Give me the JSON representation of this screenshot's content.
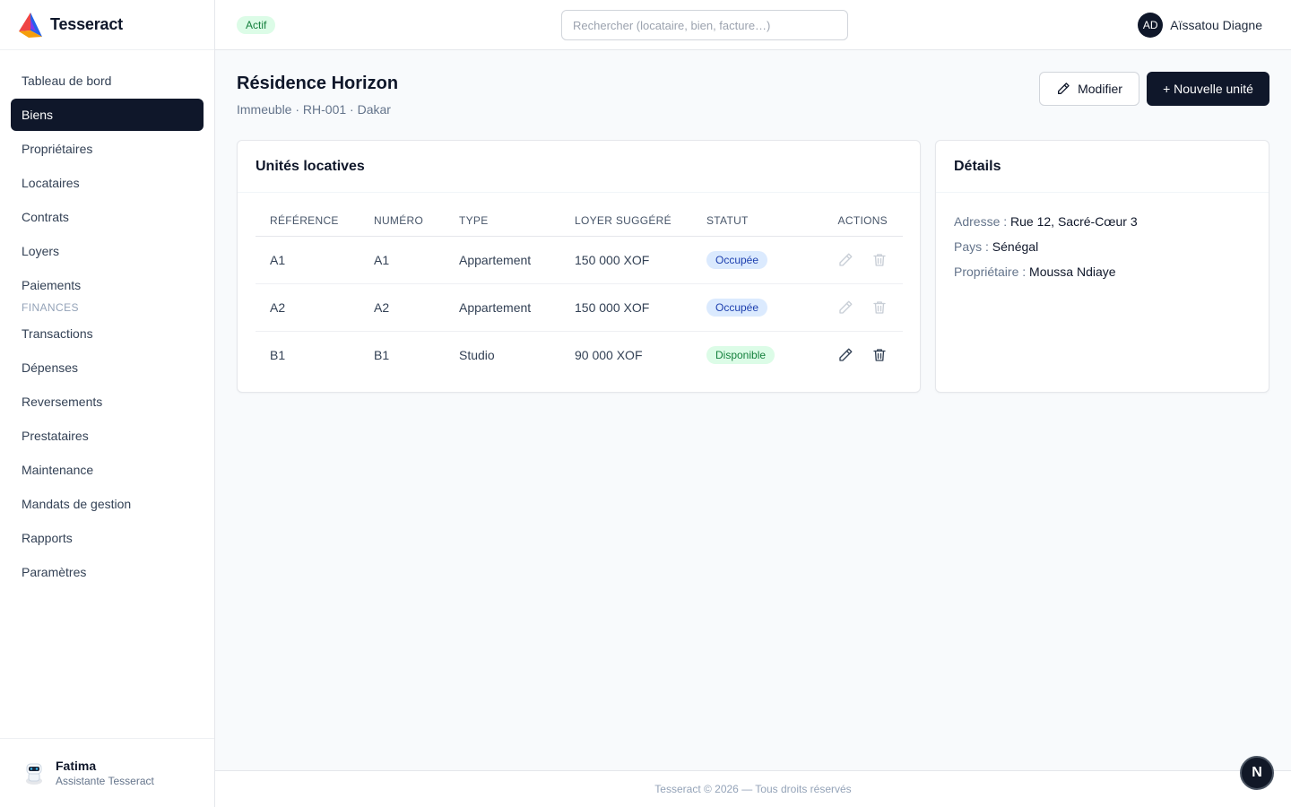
{
  "brand": {
    "name": "Tesseract"
  },
  "sidebar": {
    "items": [
      {
        "label": "Tableau de bord"
      },
      {
        "label": "Biens"
      },
      {
        "label": "Propriétaires"
      },
      {
        "label": "Locataires"
      },
      {
        "label": "Contrats"
      },
      {
        "label": "Loyers"
      },
      {
        "label": "Paiements"
      }
    ],
    "section_finances": "FINANCES",
    "finance_items": [
      {
        "label": "Transactions"
      },
      {
        "label": "Dépenses"
      },
      {
        "label": "Reversements"
      },
      {
        "label": "Prestataires"
      },
      {
        "label": "Maintenance"
      },
      {
        "label": "Mandats de gestion"
      },
      {
        "label": "Rapports"
      },
      {
        "label": "Paramètres"
      }
    ],
    "active": "Biens"
  },
  "assistant": {
    "name": "Fatima",
    "role": "Assistante Tesseract"
  },
  "topbar": {
    "status": "Actif",
    "search_placeholder": "Rechercher (locataire, bien, facture…)",
    "user_initials": "AD",
    "user_name": "Aïssatou Diagne"
  },
  "page": {
    "title": "Résidence Horizon",
    "subtitle": "Immeuble · RH-001 · Dakar",
    "edit_label": "Modifier",
    "new_label": "+ Nouvelle unité"
  },
  "units": {
    "title": "Unités locatives",
    "columns": [
      "RÉFÉRENCE",
      "NUMÉRO",
      "TYPE",
      "LOYER SUGGÉRÉ",
      "STATUT",
      "ACTIONS"
    ],
    "rows": [
      {
        "ref": "A1",
        "num": "A1",
        "type": "Appartement",
        "rent": "150 000 XOF",
        "status": "Occupée"
      },
      {
        "ref": "A2",
        "num": "A2",
        "type": "Appartement",
        "rent": "150 000 XOF",
        "status": "Occupée"
      },
      {
        "ref": "B1",
        "num": "B1",
        "type": "Studio",
        "rent": "90 000 XOF",
        "status": "Disponible"
      }
    ]
  },
  "details": {
    "title": "Détails",
    "address_label": "Adresse :",
    "address_value": "Rue 12, Sacré-Cœur 3",
    "country_label": "Pays :",
    "country_value": "Sénégal",
    "owner_label": "Propriétaire :",
    "owner_value": "Moussa Ndiaye"
  },
  "footer": {
    "text": "Tesseract © 2026 — Tous droits réservés"
  },
  "fab": {
    "label": "N"
  },
  "colors": {
    "primary": "#0f172a",
    "occupied_bg": "#dbeafe",
    "available_bg": "#dcfce7"
  }
}
